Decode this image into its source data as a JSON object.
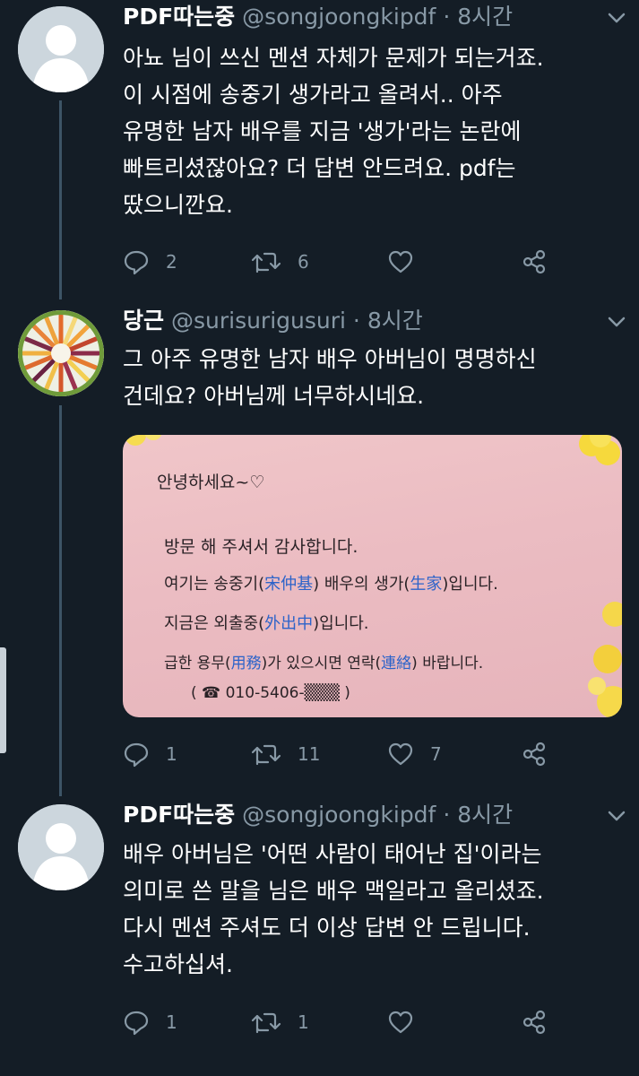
{
  "tweets": [
    {
      "display_name": "PDF따는중",
      "handle": "@songjoongkipdf",
      "separator": "·",
      "time": "8시간",
      "lines": [
        "아뇨 님이 쓰신 멘션 자체가 문제가 되는거죠.",
        "이 시점에 송중기 생가라고 올려서.. 아주",
        "유명한 남자 배우를 지금 '생가'라는 논란에",
        "빠트리셨잖아요? 더 답변 안드려요. pdf는",
        "땄으니깐요."
      ],
      "reply_count": "2",
      "retweet_count": "6",
      "like_count": ""
    },
    {
      "display_name": "당근",
      "handle": "@surisurigusuri",
      "separator": "·",
      "time": "8시간",
      "lines": [
        "그 아주 유명한 남자 배우 아버님이 명명하신",
        "건데요? 아버님께 너무하시네요."
      ],
      "reply_count": "1",
      "retweet_count": "11",
      "like_count": "7",
      "photo": {
        "greeting": "안녕하세요~♡",
        "line1": "방문 해 주셔서 감사합니다.",
        "line2_a": "여기는 송중기(",
        "line2_hanja": "宋仲基",
        "line2_b": ") 배우의 생가(",
        "line2_hanja2": "生家",
        "line2_c": ")입니다.",
        "line3_a": "지금은 외출중(",
        "line3_hanja": "外出中",
        "line3_b": ")입니다.",
        "line4_a": "급한 용무(",
        "line4_hanja": "用務",
        "line4_b": ")가 있으시면 연락(",
        "line4_hanja2": "連絡",
        "line4_c": ") 바랍니다.",
        "phone": "( ☎ 010-5406-▒▒▒ )"
      }
    },
    {
      "display_name": "PDF따는중",
      "handle": "@songjoongkipdf",
      "separator": "·",
      "time": "8시간",
      "lines": [
        "배우 아버님은 '어떤 사람이 태어난 집'이라는",
        "의미로 쓴 말을 님은 배우 맥일라고 올리셨죠.",
        "다시 멘션 주셔도 더 이상 답변 안 드립니다.",
        "수고하십셔."
      ],
      "reply_count": "1",
      "retweet_count": "1",
      "like_count": ""
    }
  ],
  "colors": {
    "background": "#141d26",
    "text": "#ffffff",
    "muted": "#8899a6",
    "thread_line": "#3d5466"
  },
  "icons": [
    "reply-icon",
    "retweet-icon",
    "like-icon",
    "share-icon",
    "caret-down-icon",
    "default-avatar-icon"
  ]
}
